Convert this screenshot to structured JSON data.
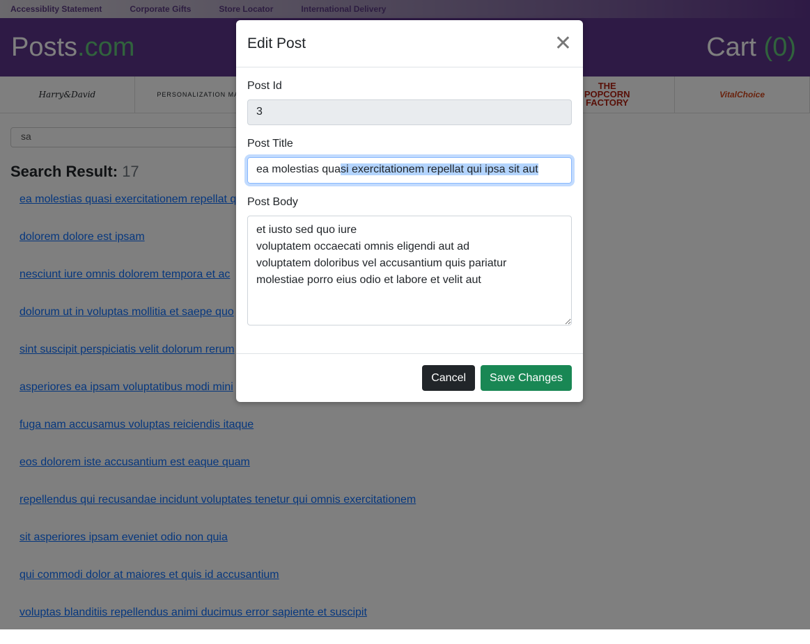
{
  "topbar": {
    "links": [
      "Accessiblity Statement",
      "Corporate Gifts",
      "Store Locator",
      "International Delivery"
    ]
  },
  "header": {
    "brand_main": "Posts",
    "brand_suffix": ".com",
    "cart_label": "Cart",
    "cart_count": "(0)"
  },
  "logos": [
    "Harry&David",
    "PERSONALIZATION MALL",
    "",
    "",
    "THE POPCORN FACTORY",
    "VitalChoice"
  ],
  "search": {
    "value": "sa"
  },
  "results": {
    "label": "Search Result:",
    "count": "17",
    "items": [
      "ea molestias quasi exercitationem repellat qui ipsa sit aut",
      "dolorem dolore est ipsam",
      "nesciunt iure omnis dolorem tempora et ac",
      "dolorum ut in voluptas mollitia et saepe quo",
      "sint suscipit perspiciatis velit dolorum rerum",
      "asperiores ea ipsam voluptatibus modi mini",
      "fuga nam accusamus voluptas reiciendis itaque",
      "eos dolorem iste accusantium est eaque quam",
      "repellendus qui recusandae incidunt voluptates tenetur qui omnis exercitationem",
      "sit asperiores ipsam eveniet odio non quia",
      "qui commodi dolor at maiores et quis id accusantium",
      "voluptas blanditiis repellendus animi ducimus error sapiente et suscipit"
    ]
  },
  "modal": {
    "title": "Edit Post",
    "id_label": "Post Id",
    "id_value": "3",
    "title_label": "Post Title",
    "title_value_pre": "ea molestias qua",
    "title_value_sel": "si exercitationem repellat qui ipsa sit aut",
    "body_label": "Post Body",
    "body_value": "et iusto sed quo iure\nvoluptatem occaecati omnis eligendi aut ad\nvoluptatem doloribus vel accusantium quis pariatur\nmolestiae porro eius odio et labore et velit aut",
    "cancel": "Cancel",
    "save": "Save Changes"
  }
}
